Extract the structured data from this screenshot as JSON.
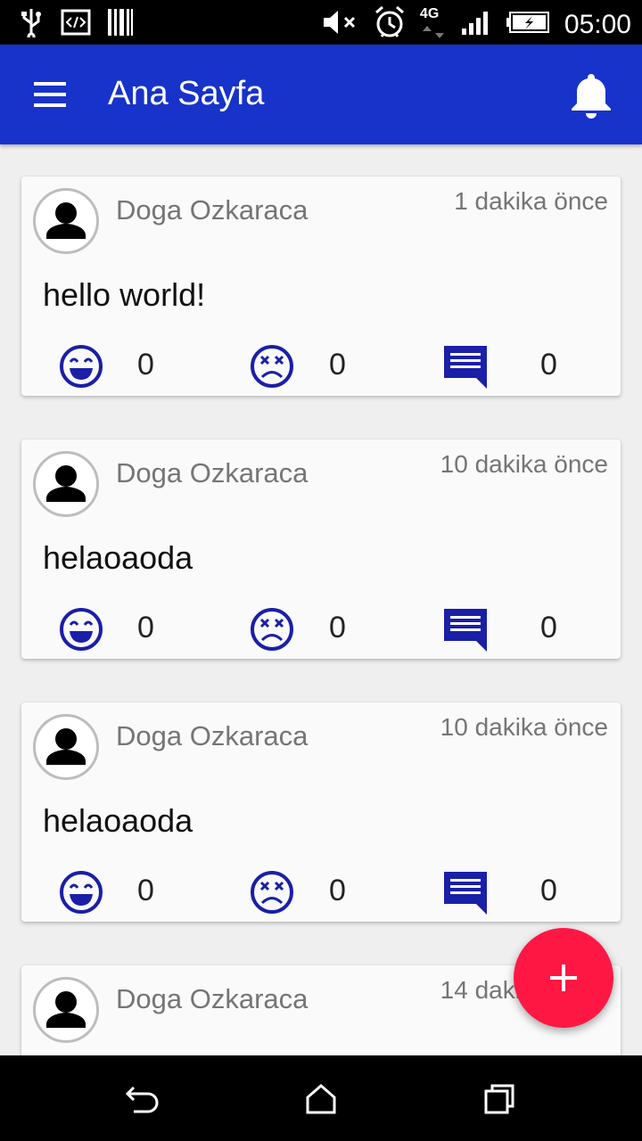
{
  "status_bar": {
    "time": "05:00",
    "network": "4G",
    "icons": [
      "usb-icon",
      "dev-tools-icon",
      "barcode-icon",
      "mute-icon",
      "alarm-icon",
      "signal-icon",
      "battery-charging-icon"
    ]
  },
  "app_bar": {
    "title": "Ana Sayfa",
    "menu_icon": "menu-icon",
    "notification_icon": "bell-icon",
    "color": "#1733c9"
  },
  "posts": [
    {
      "author": "Doga Ozkaraca",
      "time": "1 dakika önce",
      "text": "hello world!",
      "likes": "0",
      "dislikes": "0",
      "comments": "0"
    },
    {
      "author": "Doga Ozkaraca",
      "time": "10 dakika önce",
      "text": "helaoaoda",
      "likes": "0",
      "dislikes": "0",
      "comments": "0"
    },
    {
      "author": "Doga Ozkaraca",
      "time": "10 dakika önce",
      "text": "helaoaoda",
      "likes": "0",
      "dislikes": "0",
      "comments": "0"
    },
    {
      "author": "Doga Ozkaraca",
      "time": "14 dakika önce",
      "text": "",
      "likes": "",
      "dislikes": "",
      "comments": ""
    }
  ],
  "fab": {
    "icon": "plus-icon",
    "color": "#ff1744"
  },
  "accent_icon_color": "#1a1fa8",
  "nav_bar": [
    "back-icon",
    "home-icon",
    "recents-icon"
  ]
}
